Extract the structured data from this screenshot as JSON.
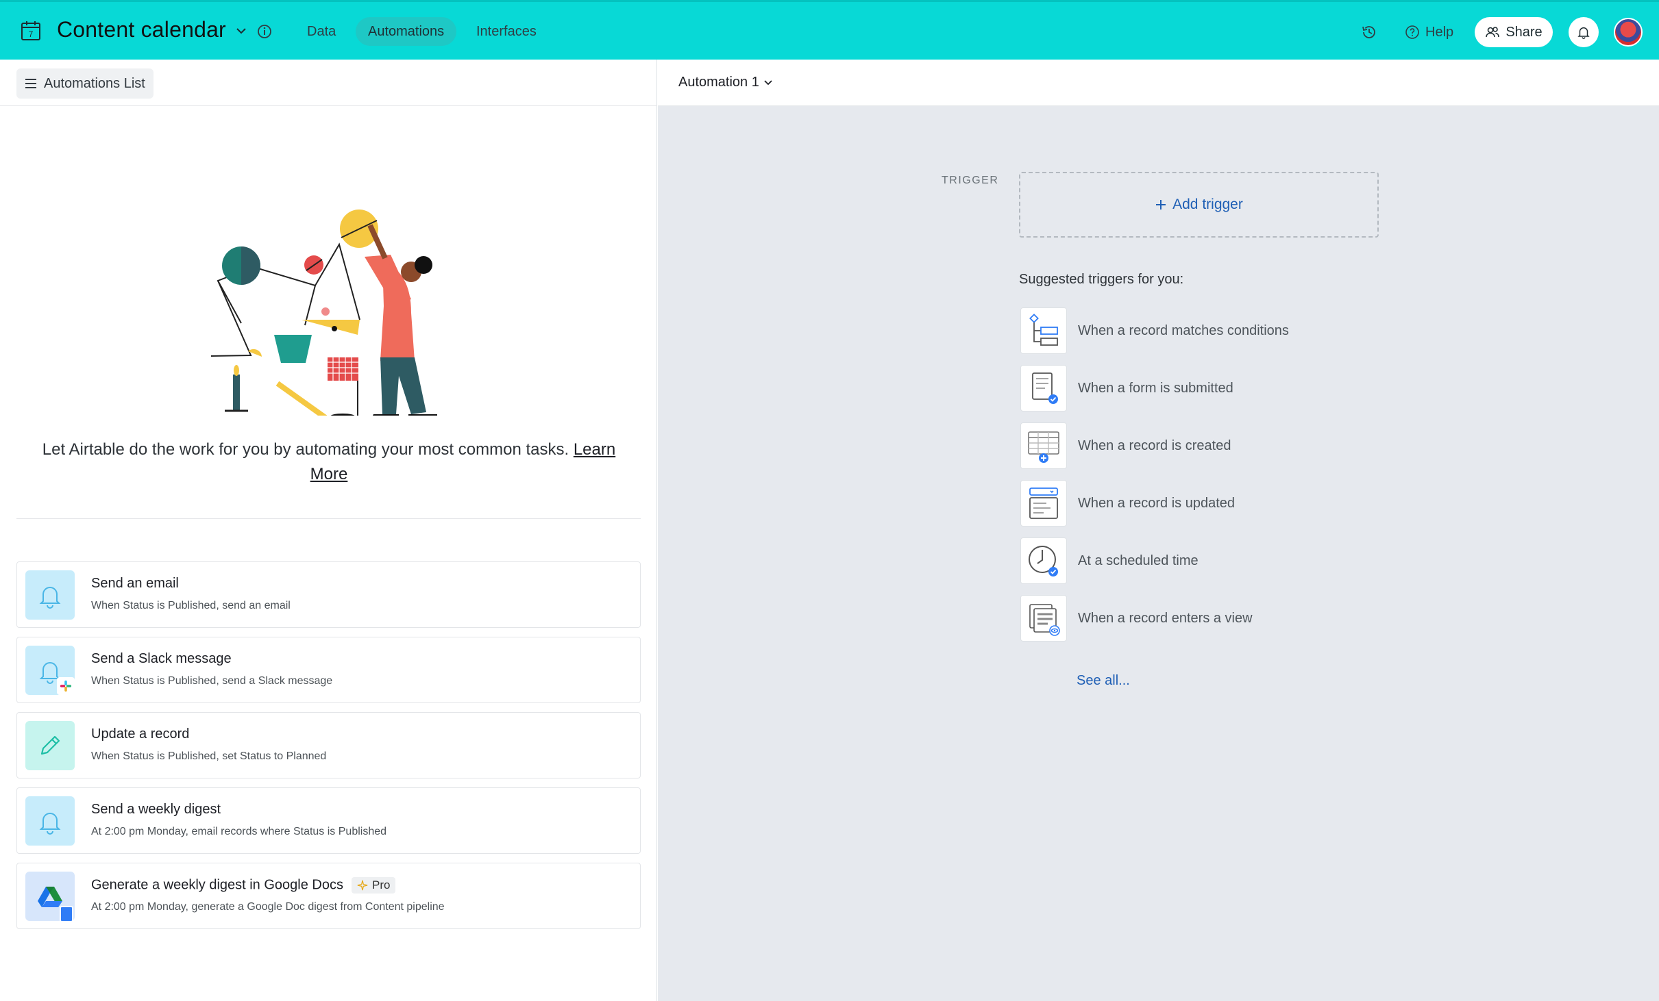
{
  "header": {
    "base_title": "Content calendar",
    "tabs": [
      {
        "label": "Data"
      },
      {
        "label": "Automations"
      },
      {
        "label": "Interfaces"
      }
    ],
    "help_label": "Help",
    "share_label": "Share",
    "accent_color": "#08d9d6"
  },
  "left": {
    "list_button_label": "Automations List",
    "intro_text": "Let Airtable do the work for you by automating your most common tasks.",
    "learn_more_label": "Learn More",
    "suggestions": [
      {
        "title": "Send an email",
        "description": "When Status is Published, send an email",
        "icon": "bell-icon"
      },
      {
        "title": "Send a Slack message",
        "description": "When Status is Published, send a Slack message",
        "icon": "bell-icon"
      },
      {
        "title": "Update a record",
        "description": "When Status is Published, set Status to Planned",
        "icon": "pencil-icon"
      },
      {
        "title": "Send a weekly digest",
        "description": "At 2:00 pm Monday, email records where Status is Published",
        "icon": "bell-icon"
      },
      {
        "title": "Generate a weekly digest in Google Docs",
        "description": "At 2:00 pm Monday, generate a Google Doc digest from Content pipeline",
        "icon": "google-drive-icon",
        "badge": "Pro"
      }
    ]
  },
  "right": {
    "automation_name": "Automation 1",
    "trigger_label": "TRIGGER",
    "add_trigger_label": "Add trigger",
    "suggested_heading": "Suggested triggers for you:",
    "triggers": [
      {
        "label": "When a record matches conditions",
        "icon": "conditions-icon"
      },
      {
        "label": "When a form is submitted",
        "icon": "form-icon"
      },
      {
        "label": "When a record is created",
        "icon": "record-created-icon"
      },
      {
        "label": "When a record is updated",
        "icon": "record-updated-icon"
      },
      {
        "label": "At a scheduled time",
        "icon": "clock-icon"
      },
      {
        "label": "When a record enters a view",
        "icon": "view-icon"
      }
    ],
    "see_all_label": "See all..."
  }
}
